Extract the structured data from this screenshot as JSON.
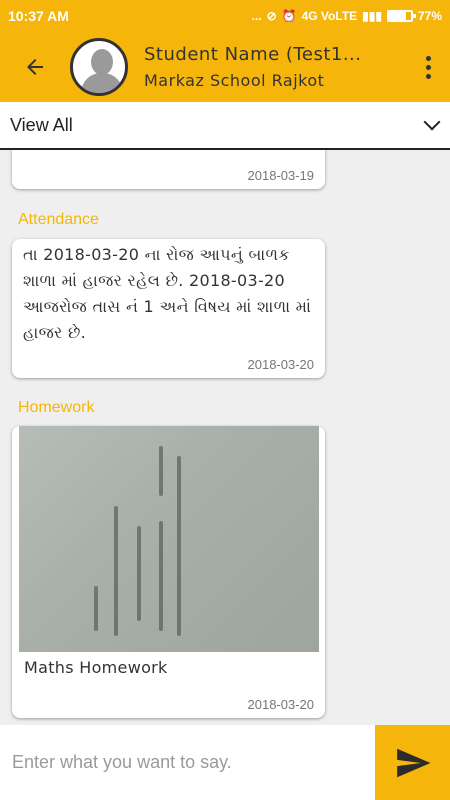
{
  "status_bar": {
    "time": "10:37 AM",
    "notification_icons": "...",
    "network": "4G VoLTE",
    "battery_percent": "77%",
    "battery_level": 0.77
  },
  "header": {
    "title": "Student Name (Test1...",
    "subtitle": "Markaz School Rajkot"
  },
  "filter": {
    "selected": "View All"
  },
  "feed": [
    {
      "date": "2018-03-19"
    },
    {
      "category": "Attendance",
      "text": "તા 2018-03-20 ના રોજ આપનું બાળક શાળા માં હાજર રહેલ છે. 2018-03-20 આજરોજ તાસ નં 1 અને વિષય માં શાળા માં હાજર છે.",
      "date": "2018-03-20"
    },
    {
      "category": "Homework",
      "caption": "Maths Homework",
      "date": "2018-03-20"
    }
  ],
  "composer": {
    "placeholder": "Enter what you want to say."
  },
  "colors": {
    "accent": "#f5b50a",
    "background": "#efefef"
  }
}
